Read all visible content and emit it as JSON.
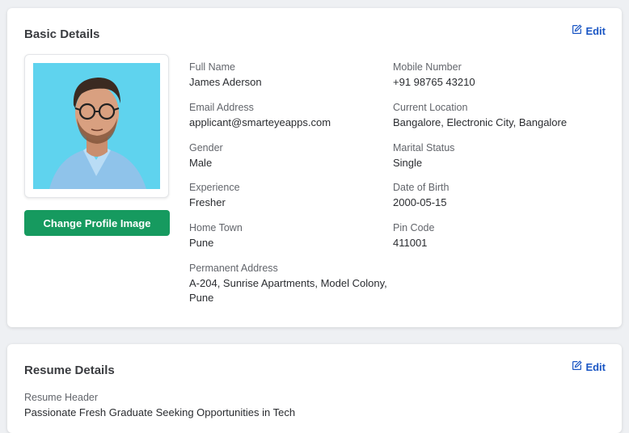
{
  "basic_details": {
    "title": "Basic Details",
    "edit_label": "Edit",
    "change_image_label": "Change Profile Image",
    "fields": [
      {
        "label": "Full Name",
        "value": "James Aderson"
      },
      {
        "label": "Mobile Number",
        "value": "+91 98765 43210"
      },
      {
        "label": "Email Address",
        "value": "applicant@smarteyeapps.com"
      },
      {
        "label": "Current Location",
        "value": "Bangalore, Electronic City, Bangalore"
      },
      {
        "label": "Gender",
        "value": "Male"
      },
      {
        "label": "Marital Status",
        "value": "Single"
      },
      {
        "label": "Experience",
        "value": "Fresher"
      },
      {
        "label": "Date of Birth",
        "value": "2000-05-15"
      },
      {
        "label": "Home Town",
        "value": "Pune"
      },
      {
        "label": "Pin Code",
        "value": "411001"
      },
      {
        "label": "Permanent Address",
        "value": "A-204, Sunrise Apartments, Model Colony, Pune"
      }
    ]
  },
  "resume_details": {
    "title": "Resume Details",
    "edit_label": "Edit",
    "fields": [
      {
        "label": "Resume Header",
        "value": "Passionate Fresh Graduate Seeking Opportunities in Tech"
      }
    ]
  },
  "colors": {
    "accent": "#1a56c4",
    "primary_button": "#169a5f",
    "photo_background": "#5fd3ee"
  },
  "icons": {
    "edit": "edit-icon",
    "profile_photo": "profile-photo"
  }
}
